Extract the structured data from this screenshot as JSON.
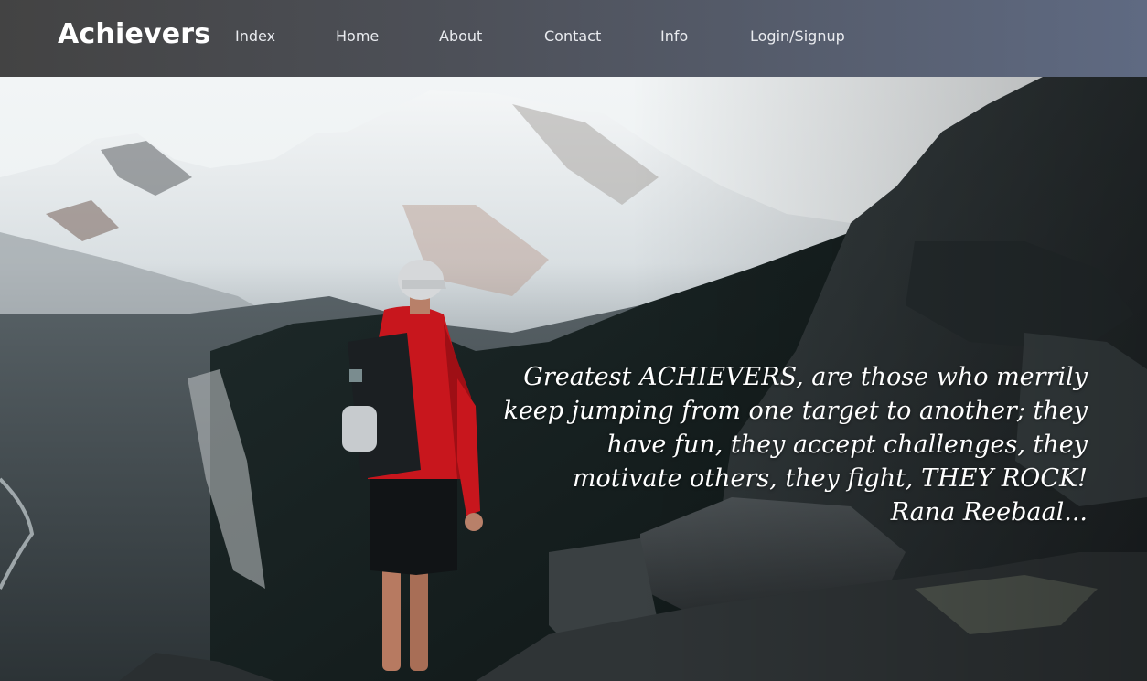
{
  "navbar": {
    "brand": "Achievers",
    "links": [
      "Index",
      "Home",
      "About",
      "Contact",
      "Info",
      "Login/Signup"
    ]
  },
  "hero": {
    "image": "mountain-hiker-background",
    "quote": "Greatest ACHIEVERS, are those who merrily keep jumping from one target to another; they have fun, they accept challenges, they motivate others, they fight, THEY ROCK!",
    "author": "Rana Reebaal..."
  },
  "colors": {
    "nav_start": "#434343",
    "nav_end": "#5f6a82",
    "text": "#ffffff",
    "jacket": "#c8161d"
  }
}
